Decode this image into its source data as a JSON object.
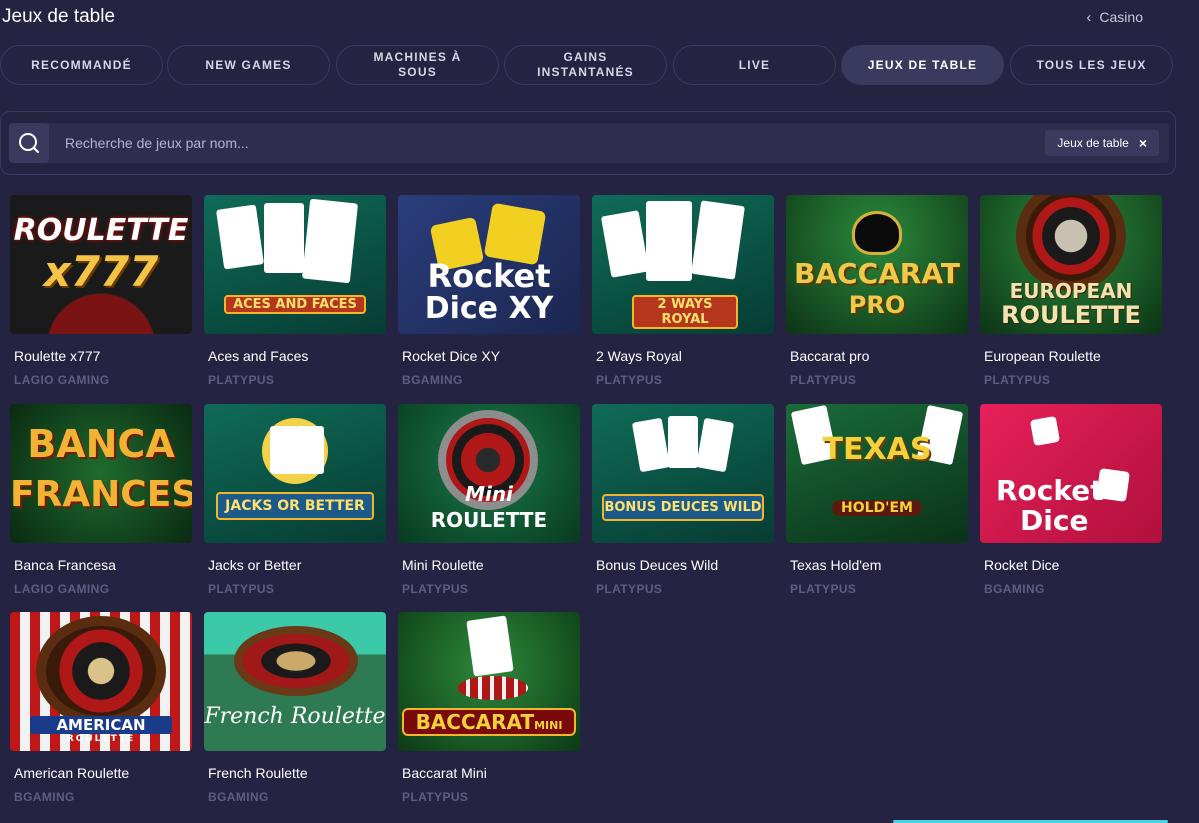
{
  "header": {
    "title": "Jeux de table",
    "back_label": "Casino"
  },
  "tabs": [
    {
      "label": "RECOMMANDÉ",
      "active": false
    },
    {
      "label": "NEW GAMES",
      "active": false
    },
    {
      "label": "MACHINES À SOUS",
      "active": false
    },
    {
      "label": "GAINS INSTANTANÉS",
      "active": false
    },
    {
      "label": "LIVE",
      "active": false
    },
    {
      "label": "JEUX DE TABLE",
      "active": true
    },
    {
      "label": "TOUS LES JEUX",
      "active": false
    }
  ],
  "search": {
    "placeholder": "Recherche de jeux par nom...",
    "value": "",
    "filter_chip": "Jeux de table"
  },
  "games": [
    {
      "name": "Roulette x777",
      "provider": "LAGIO GAMING",
      "art": [
        "ROULETTE",
        "x777"
      ]
    },
    {
      "name": "Aces and Faces",
      "provider": "PLATYPUS",
      "art": [
        "ACES AND FACES"
      ]
    },
    {
      "name": "Rocket Dice XY",
      "provider": "BGAMING",
      "art": [
        "Rocket",
        "Dice XY"
      ]
    },
    {
      "name": "2 Ways Royal",
      "provider": "PLATYPUS",
      "art": [
        "2 WAYS ROYAL"
      ]
    },
    {
      "name": "Baccarat pro",
      "provider": "PLATYPUS",
      "art": [
        "BACCARAT",
        "PRO"
      ]
    },
    {
      "name": "European Roulette",
      "provider": "PLATYPUS",
      "art": [
        "EUROPEAN",
        "ROULETTE"
      ]
    },
    {
      "name": "Banca Francesa",
      "provider": "LAGIO GAMING",
      "art": [
        "BANCA",
        "FRANCESA"
      ]
    },
    {
      "name": "Jacks or Better",
      "provider": "PLATYPUS",
      "art": [
        "JACKS OR BETTER"
      ]
    },
    {
      "name": "Mini Roulette",
      "provider": "PLATYPUS",
      "art": [
        "Mini",
        "ROULETTE"
      ]
    },
    {
      "name": "Bonus Deuces Wild",
      "provider": "PLATYPUS",
      "art": [
        "BONUS DEUCES WILD"
      ]
    },
    {
      "name": "Texas Hold'em",
      "provider": "PLATYPUS",
      "art": [
        "TEXAS",
        "HOLD'EM"
      ]
    },
    {
      "name": "Rocket Dice",
      "provider": "BGAMING",
      "art": [
        "Rocket",
        "Dice"
      ]
    },
    {
      "name": "American Roulette",
      "provider": "BGAMING",
      "art": [
        "AMERICAN",
        "ROULETTE"
      ]
    },
    {
      "name": "French Roulette",
      "provider": "BGAMING",
      "art": [
        "French Roulette"
      ]
    },
    {
      "name": "Baccarat Mini",
      "provider": "PLATYPUS",
      "art": [
        "BACCARAT",
        "MINI"
      ]
    }
  ],
  "colors": {
    "background": "#242342",
    "tab_active": "#3a3a5e",
    "provider_text": "#5e5d80",
    "accent": "#4ad1e6"
  }
}
